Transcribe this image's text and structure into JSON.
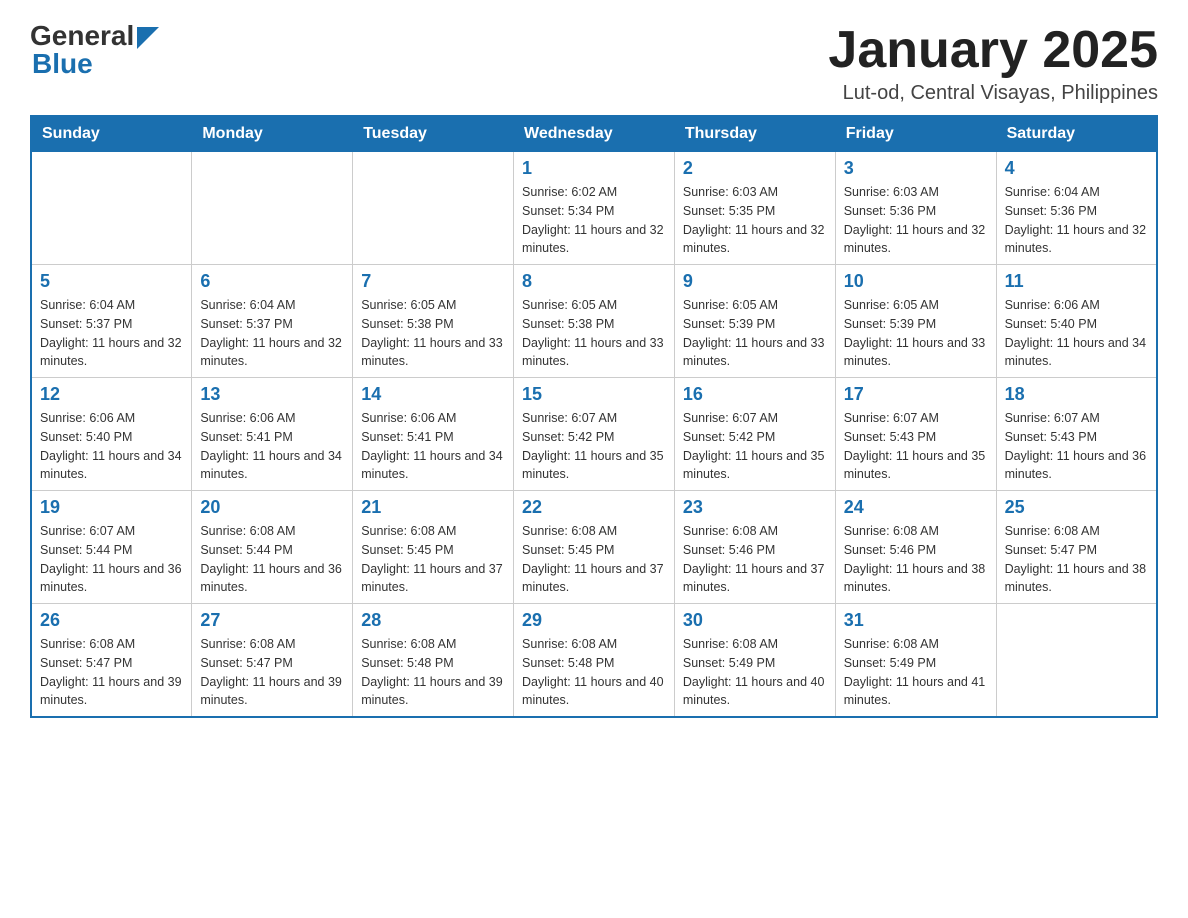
{
  "header": {
    "logo_general": "General",
    "logo_blue": "Blue",
    "title": "January 2025",
    "subtitle": "Lut-od, Central Visayas, Philippines"
  },
  "weekdays": [
    "Sunday",
    "Monday",
    "Tuesday",
    "Wednesday",
    "Thursday",
    "Friday",
    "Saturday"
  ],
  "weeks": [
    [
      {
        "day": "",
        "sunrise": "",
        "sunset": "",
        "daylight": ""
      },
      {
        "day": "",
        "sunrise": "",
        "sunset": "",
        "daylight": ""
      },
      {
        "day": "",
        "sunrise": "",
        "sunset": "",
        "daylight": ""
      },
      {
        "day": "1",
        "sunrise": "Sunrise: 6:02 AM",
        "sunset": "Sunset: 5:34 PM",
        "daylight": "Daylight: 11 hours and 32 minutes."
      },
      {
        "day": "2",
        "sunrise": "Sunrise: 6:03 AM",
        "sunset": "Sunset: 5:35 PM",
        "daylight": "Daylight: 11 hours and 32 minutes."
      },
      {
        "day": "3",
        "sunrise": "Sunrise: 6:03 AM",
        "sunset": "Sunset: 5:36 PM",
        "daylight": "Daylight: 11 hours and 32 minutes."
      },
      {
        "day": "4",
        "sunrise": "Sunrise: 6:04 AM",
        "sunset": "Sunset: 5:36 PM",
        "daylight": "Daylight: 11 hours and 32 minutes."
      }
    ],
    [
      {
        "day": "5",
        "sunrise": "Sunrise: 6:04 AM",
        "sunset": "Sunset: 5:37 PM",
        "daylight": "Daylight: 11 hours and 32 minutes."
      },
      {
        "day": "6",
        "sunrise": "Sunrise: 6:04 AM",
        "sunset": "Sunset: 5:37 PM",
        "daylight": "Daylight: 11 hours and 32 minutes."
      },
      {
        "day": "7",
        "sunrise": "Sunrise: 6:05 AM",
        "sunset": "Sunset: 5:38 PM",
        "daylight": "Daylight: 11 hours and 33 minutes."
      },
      {
        "day": "8",
        "sunrise": "Sunrise: 6:05 AM",
        "sunset": "Sunset: 5:38 PM",
        "daylight": "Daylight: 11 hours and 33 minutes."
      },
      {
        "day": "9",
        "sunrise": "Sunrise: 6:05 AM",
        "sunset": "Sunset: 5:39 PM",
        "daylight": "Daylight: 11 hours and 33 minutes."
      },
      {
        "day": "10",
        "sunrise": "Sunrise: 6:05 AM",
        "sunset": "Sunset: 5:39 PM",
        "daylight": "Daylight: 11 hours and 33 minutes."
      },
      {
        "day": "11",
        "sunrise": "Sunrise: 6:06 AM",
        "sunset": "Sunset: 5:40 PM",
        "daylight": "Daylight: 11 hours and 34 minutes."
      }
    ],
    [
      {
        "day": "12",
        "sunrise": "Sunrise: 6:06 AM",
        "sunset": "Sunset: 5:40 PM",
        "daylight": "Daylight: 11 hours and 34 minutes."
      },
      {
        "day": "13",
        "sunrise": "Sunrise: 6:06 AM",
        "sunset": "Sunset: 5:41 PM",
        "daylight": "Daylight: 11 hours and 34 minutes."
      },
      {
        "day": "14",
        "sunrise": "Sunrise: 6:06 AM",
        "sunset": "Sunset: 5:41 PM",
        "daylight": "Daylight: 11 hours and 34 minutes."
      },
      {
        "day": "15",
        "sunrise": "Sunrise: 6:07 AM",
        "sunset": "Sunset: 5:42 PM",
        "daylight": "Daylight: 11 hours and 35 minutes."
      },
      {
        "day": "16",
        "sunrise": "Sunrise: 6:07 AM",
        "sunset": "Sunset: 5:42 PM",
        "daylight": "Daylight: 11 hours and 35 minutes."
      },
      {
        "day": "17",
        "sunrise": "Sunrise: 6:07 AM",
        "sunset": "Sunset: 5:43 PM",
        "daylight": "Daylight: 11 hours and 35 minutes."
      },
      {
        "day": "18",
        "sunrise": "Sunrise: 6:07 AM",
        "sunset": "Sunset: 5:43 PM",
        "daylight": "Daylight: 11 hours and 36 minutes."
      }
    ],
    [
      {
        "day": "19",
        "sunrise": "Sunrise: 6:07 AM",
        "sunset": "Sunset: 5:44 PM",
        "daylight": "Daylight: 11 hours and 36 minutes."
      },
      {
        "day": "20",
        "sunrise": "Sunrise: 6:08 AM",
        "sunset": "Sunset: 5:44 PM",
        "daylight": "Daylight: 11 hours and 36 minutes."
      },
      {
        "day": "21",
        "sunrise": "Sunrise: 6:08 AM",
        "sunset": "Sunset: 5:45 PM",
        "daylight": "Daylight: 11 hours and 37 minutes."
      },
      {
        "day": "22",
        "sunrise": "Sunrise: 6:08 AM",
        "sunset": "Sunset: 5:45 PM",
        "daylight": "Daylight: 11 hours and 37 minutes."
      },
      {
        "day": "23",
        "sunrise": "Sunrise: 6:08 AM",
        "sunset": "Sunset: 5:46 PM",
        "daylight": "Daylight: 11 hours and 37 minutes."
      },
      {
        "day": "24",
        "sunrise": "Sunrise: 6:08 AM",
        "sunset": "Sunset: 5:46 PM",
        "daylight": "Daylight: 11 hours and 38 minutes."
      },
      {
        "day": "25",
        "sunrise": "Sunrise: 6:08 AM",
        "sunset": "Sunset: 5:47 PM",
        "daylight": "Daylight: 11 hours and 38 minutes."
      }
    ],
    [
      {
        "day": "26",
        "sunrise": "Sunrise: 6:08 AM",
        "sunset": "Sunset: 5:47 PM",
        "daylight": "Daylight: 11 hours and 39 minutes."
      },
      {
        "day": "27",
        "sunrise": "Sunrise: 6:08 AM",
        "sunset": "Sunset: 5:47 PM",
        "daylight": "Daylight: 11 hours and 39 minutes."
      },
      {
        "day": "28",
        "sunrise": "Sunrise: 6:08 AM",
        "sunset": "Sunset: 5:48 PM",
        "daylight": "Daylight: 11 hours and 39 minutes."
      },
      {
        "day": "29",
        "sunrise": "Sunrise: 6:08 AM",
        "sunset": "Sunset: 5:48 PM",
        "daylight": "Daylight: 11 hours and 40 minutes."
      },
      {
        "day": "30",
        "sunrise": "Sunrise: 6:08 AM",
        "sunset": "Sunset: 5:49 PM",
        "daylight": "Daylight: 11 hours and 40 minutes."
      },
      {
        "day": "31",
        "sunrise": "Sunrise: 6:08 AM",
        "sunset": "Sunset: 5:49 PM",
        "daylight": "Daylight: 11 hours and 41 minutes."
      },
      {
        "day": "",
        "sunrise": "",
        "sunset": "",
        "daylight": ""
      }
    ]
  ]
}
